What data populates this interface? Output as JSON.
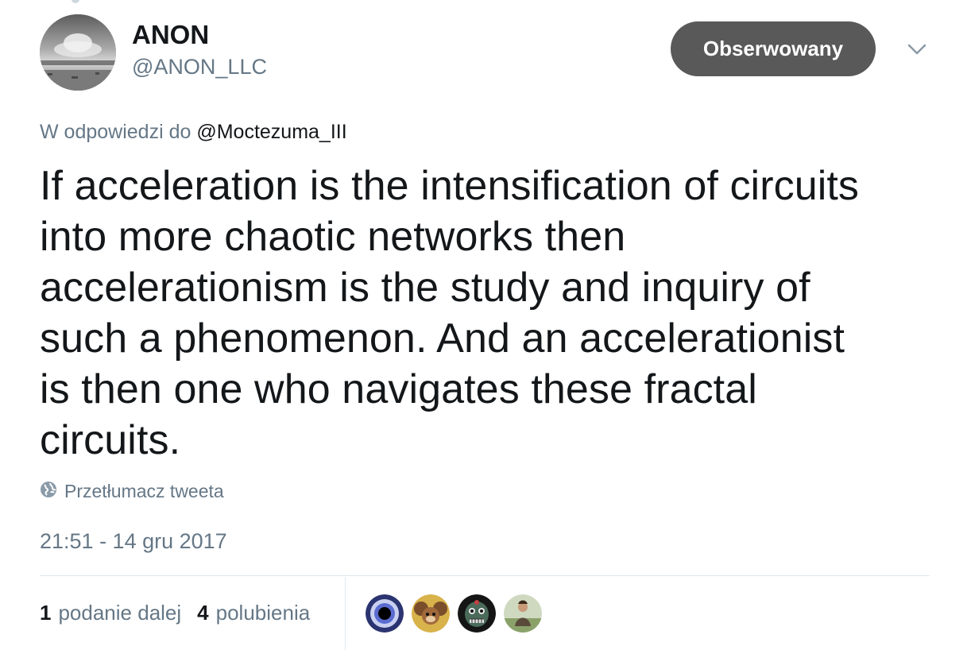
{
  "user": {
    "display_name": "ANON",
    "handle": "@ANON_LLC"
  },
  "follow_button": {
    "label": "Obserwowany"
  },
  "reply": {
    "prefix": "W odpowiedzi do",
    "mention": "@Moctezuma_III"
  },
  "tweet": {
    "text": "If acceleration is the intensification of circuits\ninto more chaotic networks then\naccelerationism is the study and inquiry of\nsuch a phenomenon. And an accelerationist\nis then one who navigates these fractal\ncircuits."
  },
  "translate": {
    "label": "Przetłumacz tweeta"
  },
  "timestamp": "21:51 - 14 gru 2017",
  "stats": {
    "retweets": {
      "count": "1",
      "label": "podanie dalej"
    },
    "likes": {
      "count": "4",
      "label": "polubienia"
    }
  },
  "colors": {
    "text": "#14171a",
    "muted": "#657786",
    "button_bg": "#595959",
    "divider": "#e1e8ed"
  },
  "icons": [
    "globe-icon",
    "chevron-down-icon"
  ]
}
